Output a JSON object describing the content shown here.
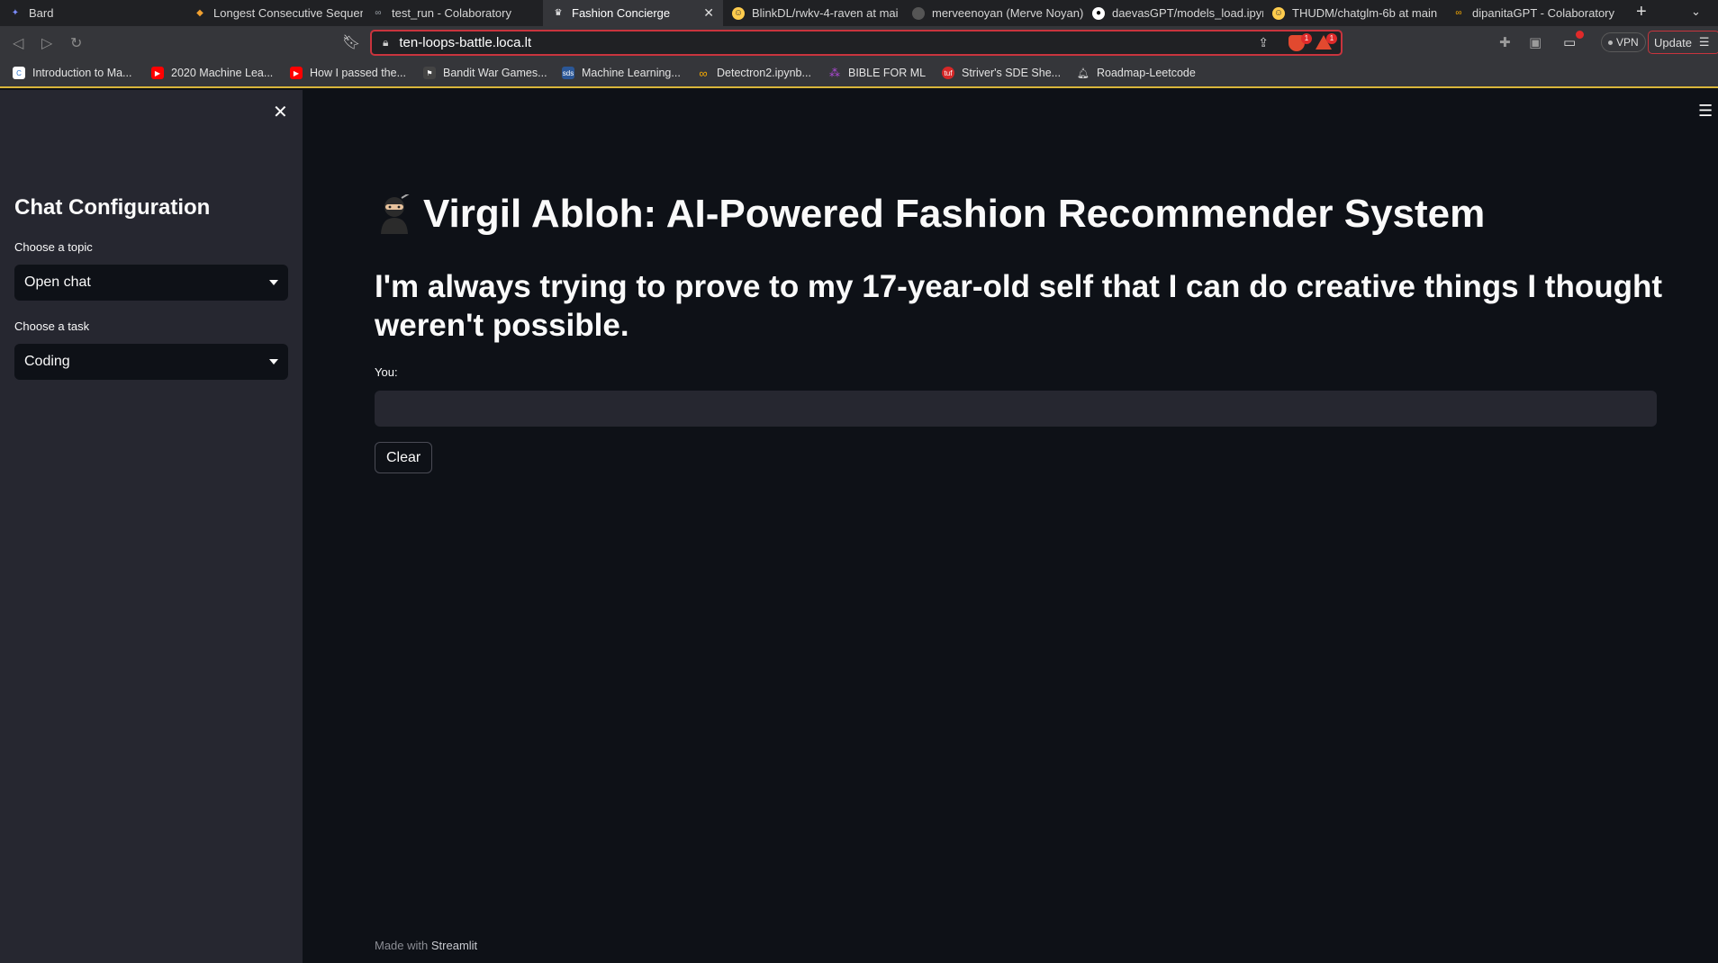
{
  "browser": {
    "tabs": [
      {
        "label": "Bard",
        "icon": "bard-icon",
        "color": "#7b8cff"
      },
      {
        "label": "Longest Consecutive Sequen",
        "icon": "leetcode-icon",
        "color": "#f0a030"
      },
      {
        "label": "test_run - Colaboratory",
        "icon": "colab-icon",
        "color": "#9aa0a6"
      },
      {
        "label": "Fashion Concierge",
        "icon": "crown-icon",
        "color": "#ffffff",
        "active": true,
        "close": "✕"
      },
      {
        "label": "BlinkDL/rwkv-4-raven at mai",
        "icon": "huggingface-icon",
        "color": "#ffcc4d"
      },
      {
        "label": "merveenoyan (Merve Noyan)",
        "icon": "huggingface-avatar-icon",
        "color": "#555555"
      },
      {
        "label": "daevasGPT/models_load.ipyn",
        "icon": "github-icon",
        "color": "#ffffff"
      },
      {
        "label": "THUDM/chatglm-6b at main",
        "icon": "huggingface-icon",
        "color": "#ffcc4d"
      },
      {
        "label": "dipanitaGPT - Colaboratory",
        "icon": "colab-icon",
        "color": "#f9ab00"
      }
    ],
    "new_tab": "+",
    "tab_overflow": "⌄",
    "url": "ten-loops-battle.loca.lt",
    "shield_badge": "1",
    "rewards_badge": "1",
    "vpn_label": "VPN",
    "update_label": "Update",
    "bookmarks": [
      {
        "label": "Introduction to Ma...",
        "icon": "coursera-icon",
        "color": "#2a73cc"
      },
      {
        "label": "2020 Machine Lea...",
        "icon": "youtube-icon",
        "color": "#ff0000"
      },
      {
        "label": "How I passed the...",
        "icon": "youtube-icon",
        "color": "#ff0000"
      },
      {
        "label": "Bandit War Games...",
        "icon": "overthewire-icon",
        "color": "#444444"
      },
      {
        "label": "Machine Learning...",
        "icon": "sds-icon",
        "color": "#2b5797"
      },
      {
        "label": "Detectron2.ipynb...",
        "icon": "colab-icon",
        "color": "#f9ab00"
      },
      {
        "label": "BIBLE FOR ML",
        "icon": "pixel-icon",
        "color": "#b04ad8"
      },
      {
        "label": "Striver's SDE She...",
        "icon": "takeuforward-icon",
        "color": "#d62828"
      },
      {
        "label": "Roadmap-Leetcode",
        "icon": "notion-bell-icon",
        "color": "#dddddd"
      }
    ]
  },
  "sidebar": {
    "close_icon": "✕",
    "title": "Chat Configuration",
    "topic_label": "Choose a topic",
    "topic_value": "Open chat",
    "task_label": "Choose a task",
    "task_value": "Coding"
  },
  "main": {
    "menu_icon": "☰",
    "title_emoji": "ninja-icon",
    "title": "Virgil Abloh: AI-Powered Fashion Recommender System",
    "subtitle": "I'm always trying to prove to my 17-year-old self that I can do creative things I thought weren't possible.",
    "input_label": "You:",
    "input_value": "",
    "clear_label": "Clear",
    "footer_prefix": "Made with",
    "footer_brand": "Streamlit"
  },
  "colors": {
    "app_bg": "#0e1117",
    "sidebar_bg": "#262730",
    "input_bg": "#262730",
    "accent_red": "#c9343d"
  }
}
